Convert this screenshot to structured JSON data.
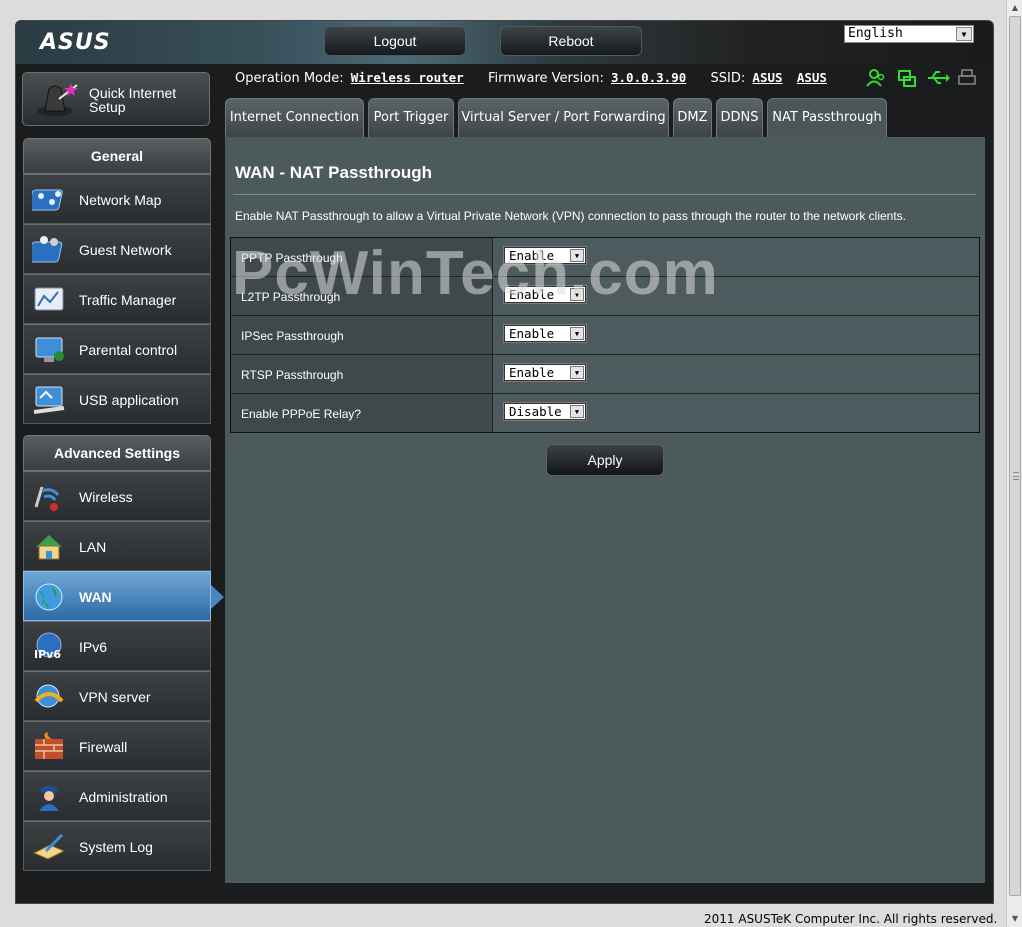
{
  "brand": {
    "logo_text": "ASUS"
  },
  "header": {
    "logout_label": "Logout",
    "reboot_label": "Reboot",
    "language": "English"
  },
  "status": {
    "operation_mode_label": "Operation Mode:",
    "operation_mode_value": "Wireless router",
    "firmware_label": "Firmware Version:",
    "firmware_value": "3.0.0.3.90",
    "ssid_label": "SSID:",
    "ssid_values": [
      "ASUS",
      "ASUS"
    ],
    "icons": [
      "clients-icon",
      "network-icon",
      "usb-icon",
      "printer-icon"
    ]
  },
  "sidebar": {
    "quick_setup": {
      "line1": "Quick Internet",
      "line2": "Setup"
    },
    "general_title": "General",
    "general_items": [
      {
        "label": "Network Map",
        "icon": "network-map-icon"
      },
      {
        "label": "Guest Network",
        "icon": "guest-network-icon"
      },
      {
        "label": "Traffic Manager",
        "icon": "traffic-manager-icon"
      },
      {
        "label": "Parental control",
        "icon": "parental-control-icon"
      },
      {
        "label": "USB application",
        "icon": "usb-application-icon"
      }
    ],
    "advanced_title": "Advanced Settings",
    "advanced_items": [
      {
        "label": "Wireless",
        "icon": "wireless-icon"
      },
      {
        "label": "LAN",
        "icon": "lan-icon"
      },
      {
        "label": "WAN",
        "icon": "wan-globe-icon",
        "active": true
      },
      {
        "label": "IPv6",
        "icon": "ipv6-icon"
      },
      {
        "label": "VPN server",
        "icon": "vpn-icon"
      },
      {
        "label": "Firewall",
        "icon": "firewall-icon"
      },
      {
        "label": "Administration",
        "icon": "administration-icon"
      },
      {
        "label": "System Log",
        "icon": "system-log-icon"
      }
    ]
  },
  "tabs": [
    {
      "label": "Internet Connection"
    },
    {
      "label": "Port Trigger"
    },
    {
      "label": "Virtual Server / Port Forwarding"
    },
    {
      "label": "DMZ"
    },
    {
      "label": "DDNS"
    },
    {
      "label": "NAT Passthrough",
      "active": true
    }
  ],
  "main": {
    "title": "WAN - NAT Passthrough",
    "description": "Enable NAT Passthrough to allow a Virtual Private Network (VPN) connection to pass through the router to the network clients.",
    "settings": [
      {
        "label": "PPTP Passthrough",
        "value": "Enable"
      },
      {
        "label": "L2TP Passthrough",
        "value": "Enable"
      },
      {
        "label": "IPSec Passthrough",
        "value": "Enable"
      },
      {
        "label": "RTSP Passthrough",
        "value": "Enable"
      },
      {
        "label": "Enable PPPoE Relay?",
        "value": "Disable"
      }
    ],
    "apply_label": "Apply"
  },
  "watermark": "PcWinTech.com",
  "footer": "2011 ASUSTeK Computer Inc. All rights reserved.",
  "colors": {
    "accent_active": "#3a7ab3",
    "status_icon": "#2fe02f",
    "panel_bg": "#4d5a5c"
  }
}
